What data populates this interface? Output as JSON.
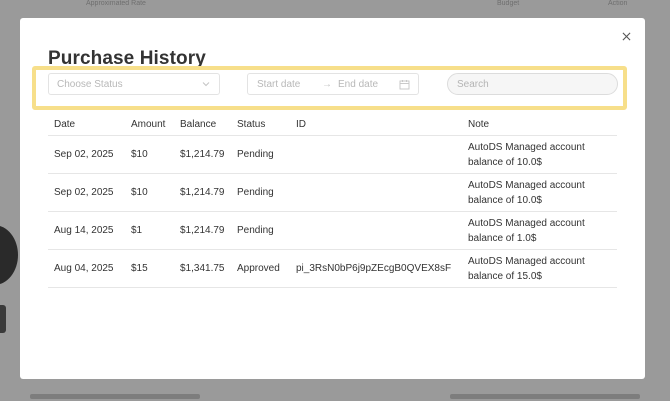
{
  "background": {
    "top_texts": [
      "Approximated Rate",
      "Budget",
      "Action"
    ],
    "bottom_texts": [
      "",
      ""
    ]
  },
  "modal": {
    "title": "Purchase History",
    "close_label": "×",
    "filters": {
      "status_placeholder": "Choose Status",
      "start_date_placeholder": "Start date",
      "end_date_placeholder": "End date",
      "arrow": "→",
      "search_placeholder": "Search"
    },
    "table": {
      "headers": {
        "date": "Date",
        "amount": "Amount",
        "balance": "Balance",
        "status": "Status",
        "id": "ID",
        "note": "Note"
      },
      "rows": [
        {
          "date": "Sep 02, 2025",
          "amount": "$10",
          "balance": "$1,214.79",
          "status": "Pending",
          "id": "",
          "note_line1": "AutoDS Managed account",
          "note_line2": "balance of 10.0$"
        },
        {
          "date": "Sep 02, 2025",
          "amount": "$10",
          "balance": "$1,214.79",
          "status": "Pending",
          "id": "",
          "note_line1": "AutoDS Managed account",
          "note_line2": "balance of 10.0$"
        },
        {
          "date": "Aug 14, 2025",
          "amount": "$1",
          "balance": "$1,214.79",
          "status": "Pending",
          "id": "",
          "note_line1": "AutoDS Managed account",
          "note_line2": "balance of 1.0$"
        },
        {
          "date": "Aug 04, 2025",
          "amount": "$15",
          "balance": "$1,341.75",
          "status": "Approved",
          "id": "pi_3RsN0bP6j9pZEcgB0QVEX8sF",
          "note_line1": "AutoDS Managed account",
          "note_line2": "balance of 15.0$"
        }
      ]
    }
  },
  "colors": {
    "highlight": "#f7df8a",
    "overlay": "#9a9a9a"
  }
}
